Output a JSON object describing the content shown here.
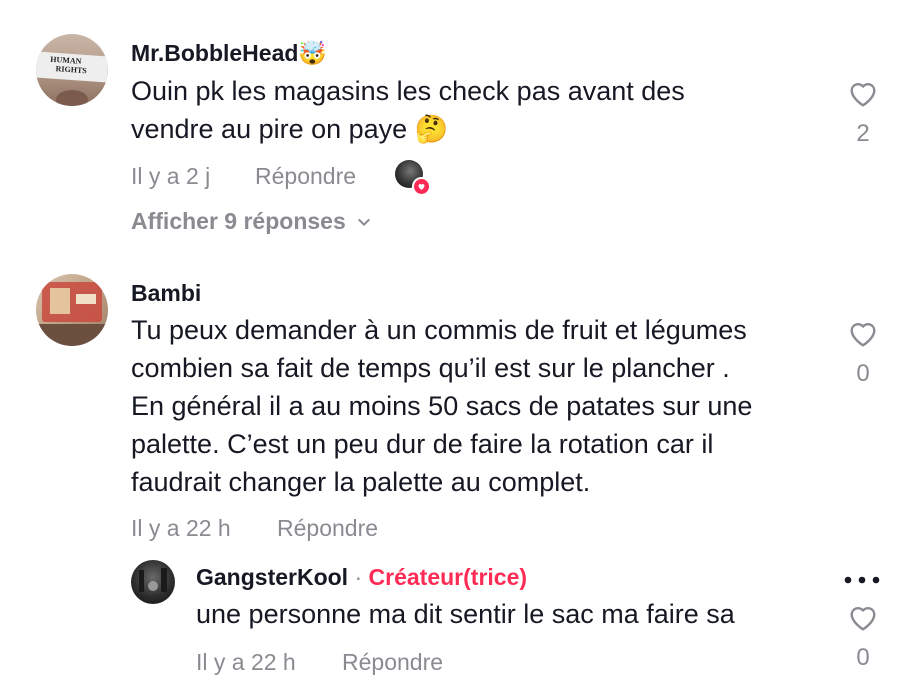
{
  "comments": [
    {
      "username": "Mr.BobbleHead",
      "badge_emoji": "🤯",
      "text_lines": [
        "Ouin pk les magasins les check pas avant des",
        "vendre au pire on paye 🤔"
      ],
      "time": "Il y a 2 j",
      "reply_label": "Répondre",
      "likes": "2",
      "avatar_text_1": "HUMAN",
      "avatar_text_2": "RIGHTS",
      "show_replies": "Afficher 9 réponses"
    },
    {
      "username": "Bambi",
      "text_lines": [
        "Tu peux demander à un commis de fruit et légumes",
        "combien sa fait de temps qu’il est sur le plancher .",
        "En général il a au moins 50 sacs de patates sur une",
        "palette. C’est un peu dur de faire la rotation car il",
        "faudrait changer la palette au complet."
      ],
      "time": "Il y a 22 h",
      "reply_label": "Répondre",
      "likes": "0"
    }
  ],
  "reply": {
    "username": "GangsterKool",
    "separator": "·",
    "creator_label": "Créateur(trice)",
    "text": "une personne ma dit sentir le sac ma faire sa",
    "time": "Il y a 22 h",
    "reply_label": "Répondre",
    "likes": "0",
    "more_icon": "more-horizontal-icon"
  },
  "colors": {
    "creator": "#fe2c55",
    "meta": "#8a8b91",
    "text": "#161823",
    "heart_badge": "#fe2c55"
  }
}
